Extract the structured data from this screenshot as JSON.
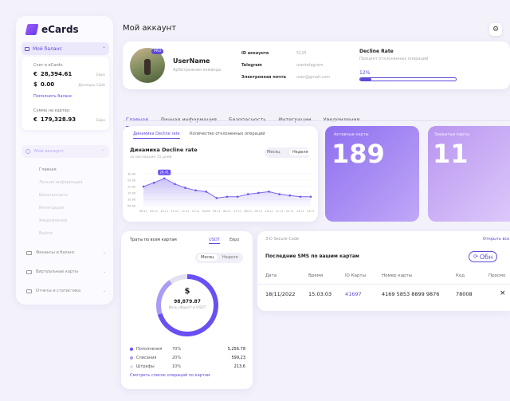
{
  "brand": {
    "name": "eCards"
  },
  "sidebar": {
    "balance_title": "Мой баланс",
    "account_label": "Счет в eCards:",
    "eur_value": "28,394.61",
    "eur_unit": "Евро",
    "usd_value": "0.00",
    "usd_unit": "Доллары США",
    "top_up": "Пополнить баланс",
    "cards_sum_label": "Сумма на картах:",
    "cards_value": "179,328.93",
    "cards_unit": "Евро",
    "section_account": "Мой аккаунт",
    "sub_items": [
      "Главная",
      "Личная информация",
      "Безопасность",
      "Интеграции",
      "Уведомления",
      "Выйти"
    ],
    "nav": [
      {
        "label": "Финансы и баланс"
      },
      {
        "label": "Виртуальные карты"
      },
      {
        "label": "Отчеты и статистика"
      }
    ]
  },
  "header": {
    "title": "Мой аккаунт"
  },
  "profile": {
    "badge": "PRO",
    "username": "UserName",
    "role": "Арбитражная команда",
    "id_label": "ID аккаунта",
    "id_value": "5125",
    "tg_label": "Telegram",
    "tg_value": "usertelegram",
    "email_label": "Электронная почта",
    "email_value": "user@gmail.com",
    "decline_title": "Decline Rate",
    "decline_sub": "Процент отклоненных операций",
    "decline_pct": "12%",
    "decline_fraction": 0.12
  },
  "tabs": [
    "Главная",
    "Личная информация",
    "Безопасность",
    "Интеграции",
    "Уведомления"
  ],
  "chart_panel": {
    "tab1": "Динамика Decline rate",
    "tab2": "Количество отклоненных операций",
    "title": "Динамика Decline rate",
    "subtitle": "за последние 15 дней",
    "btn_month": "Месяц",
    "btn_week": "Неделя",
    "highlight": "26.41"
  },
  "chart_data": {
    "type": "area",
    "title": "Динамика Decline rate",
    "y_ticks": [
      "30.00",
      "25.00",
      "20.00",
      "15.00",
      "10.00",
      "05.00"
    ],
    "ylim": [
      5,
      30
    ],
    "x": [
      "08.11",
      "09.11",
      "10.11",
      "11.11",
      "12.11",
      "13.11",
      "04.06",
      "05.11",
      "06.11",
      "07.11",
      "08.11",
      "09.11",
      "10.11",
      "11.11",
      "12.11",
      "13.11",
      "14.11"
    ],
    "values": [
      20,
      23,
      26.41,
      22,
      19,
      17,
      16,
      11,
      12,
      12,
      14,
      15,
      16,
      14,
      13,
      12,
      12
    ]
  },
  "stat1": {
    "label": "Активные карты",
    "value": "189"
  },
  "stat2": {
    "label": "Закрытые карты",
    "value": "11"
  },
  "donut": {
    "title": "Траты по всем картам",
    "cur1": "USDT",
    "cur2": "Евро",
    "btn_month": "Месяц",
    "btn_week": "Неделя",
    "symbol": "$",
    "total": "98,879.87",
    "total_label": "Весь оборот в USDT",
    "legend": [
      {
        "label": "Пополнения",
        "pct": "70%",
        "amount": "5,256.78",
        "color": "#6a4ff2",
        "frac": 0.7
      },
      {
        "label": "Списания",
        "pct": "20%",
        "amount": "599,23",
        "color": "#a99bf6",
        "frac": 0.2
      },
      {
        "label": "Штрафы",
        "pct": "10%",
        "amount": "213,6",
        "color": "#e3e0f2",
        "frac": 0.1
      }
    ],
    "link": "Смотреть список операций по картам"
  },
  "sms": {
    "top_label": "3-D Secure Code",
    "top_link": "Открыть все",
    "title": "Последние SMS по вашим картам",
    "refresh": "Обн",
    "cols": [
      "Дата",
      "Время",
      "ID Карты",
      "Номер карты",
      "Код",
      "Просмо"
    ],
    "row": {
      "date": "18/11/2022",
      "time": "15:03:03",
      "id": "41697",
      "number": "4169 5853 8899 9876",
      "code": "78008",
      "close": "×"
    }
  },
  "colors": {
    "accent": "#5b4bd8",
    "stat1_bg": "#9b7df3",
    "stat2_bg": "#c2a6f1"
  }
}
